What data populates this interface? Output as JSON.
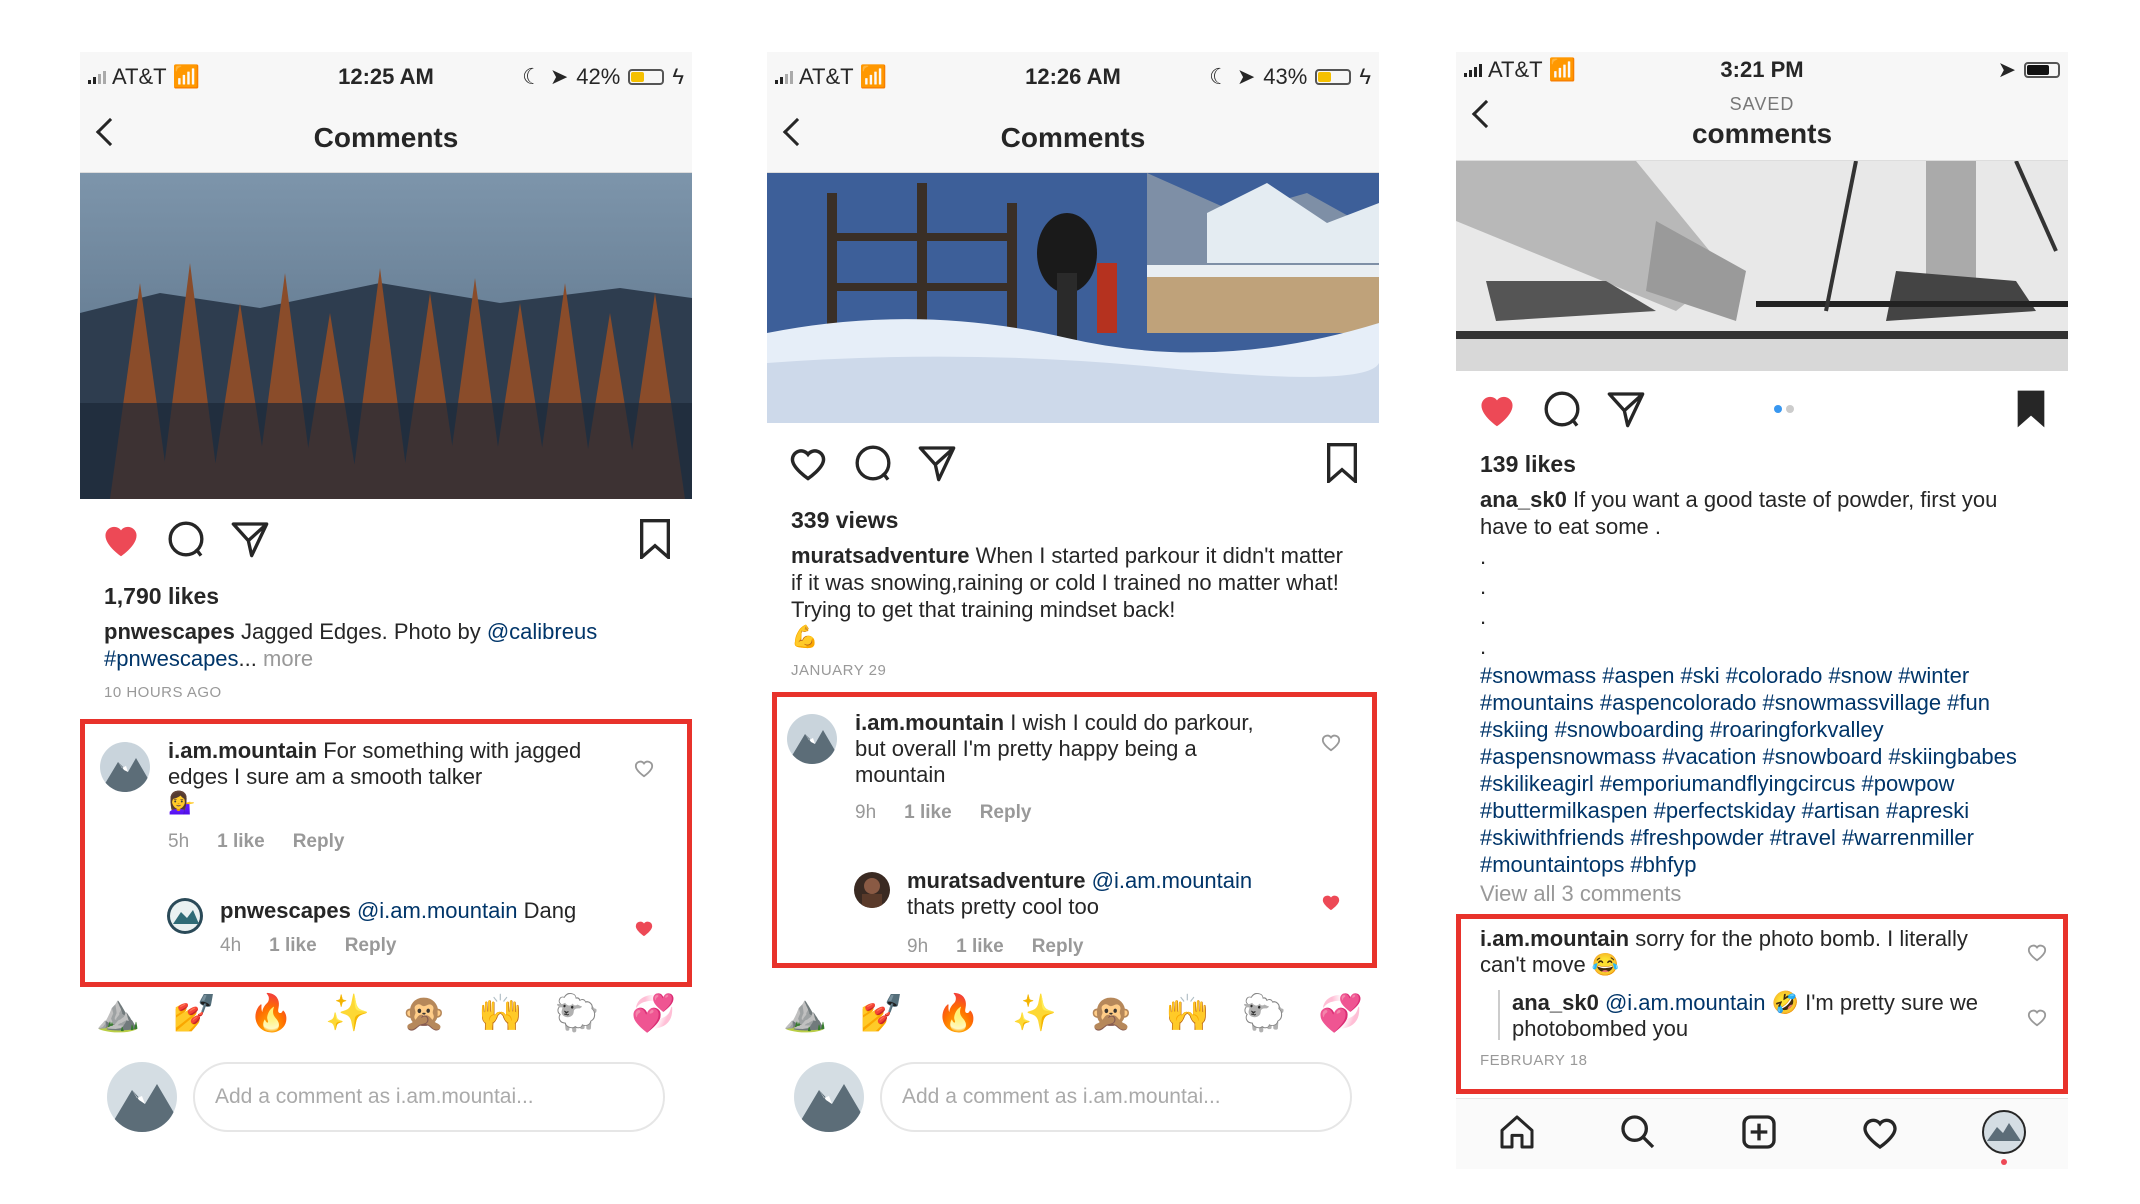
{
  "colors": {
    "accent_red": "#e8322b",
    "heart": "#ed4956",
    "link": "#003569"
  },
  "panel1": {
    "status": {
      "carrier": "AT&T",
      "time": "12:25 AM",
      "battery": "42%",
      "battery_level": 0.42
    },
    "nav_title": "Comments",
    "likes": "1,790 likes",
    "caption": {
      "user": "pnwescapes",
      "text": " Jagged Edges. Photo by ",
      "mention": "@calibreus",
      "hashtag": "#pnwescapes",
      "ellipsis": "...",
      "more": " more"
    },
    "ago": "10 HOURS AGO",
    "comment1": {
      "user": "i.am.mountain",
      "text": " For something with jagged edges I sure am a smooth talker",
      "emoji": "💁‍♀️",
      "time": "5h",
      "likes": "1 like",
      "reply": "Reply"
    },
    "reply1": {
      "user": "pnwescapes",
      "mention": " @i.am.mountain",
      "text": " Dang",
      "time": "4h",
      "likes": "1 like",
      "reply": "Reply"
    },
    "emojis": [
      "⛰️",
      "💅",
      "🔥",
      "✨",
      "🙊",
      "🙌",
      "🐑",
      "💞"
    ],
    "add_comment_placeholder": "Add a comment as i.am.mountai..."
  },
  "panel2": {
    "status": {
      "carrier": "AT&T",
      "time": "12:26 AM",
      "battery": "43%",
      "battery_level": 0.43
    },
    "nav_title": "Comments",
    "views": "339 views",
    "caption": {
      "user": "muratsadventure",
      "text": " When I started parkour it didn't matter if it was snowing,raining or cold I trained no matter what! Trying to get that training mindset back!",
      "emoji": "💪"
    },
    "date": "JANUARY 29",
    "comment1": {
      "user": "i.am.mountain",
      "text": " I wish I could do parkour, but overall I'm pretty happy being a mountain",
      "time": "9h",
      "likes": "1 like",
      "reply": "Reply"
    },
    "reply1": {
      "user": "muratsadventure",
      "mention": " @i.am.mountain",
      "text": " thats pretty cool too",
      "time": "9h",
      "likes": "1 like",
      "reply": "Reply"
    },
    "emojis": [
      "⛰️",
      "💅",
      "🔥",
      "✨",
      "🙊",
      "🙌",
      "🐑",
      "💞"
    ],
    "add_comment_placeholder": "Add a comment as i.am.mountai..."
  },
  "panel3": {
    "status": {
      "carrier": "AT&T",
      "time": "3:21 PM"
    },
    "nav_saved": "SAVED",
    "nav_title": "comments",
    "likes": "139 likes",
    "caption": {
      "user": "ana_sk0",
      "text": " If you want a good taste of powder, first you have to eat some ."
    },
    "dots": [
      ".",
      ".",
      ".",
      "."
    ],
    "hashtags": "#snowmass #aspen #ski #colorado #snow #winter #mountains #aspencolorado #snowmassvillage #fun #skiing #snowboarding #roaringforkvalley #aspensnowmass #vacation #snowboard #skiingbabes #skilikeagirl #emporiumandflyingcircus #powpow #buttermilkaspen #perfectskiday #artisan #apreski #skiwithfriends #freshpowder #travel #warrenmiller #mountaintops #bhfyp",
    "view_all": "View all 3 comments",
    "comment1": {
      "user": "i.am.mountain",
      "text": " sorry for the photo bomb. I literally can't move ",
      "emoji": "😂"
    },
    "reply1": {
      "user": "ana_sk0",
      "mention": " @i.am.mountain",
      "emoji": " 🤣",
      "text": " I'm pretty sure we photobombed you"
    },
    "date": "FEBRUARY 18"
  }
}
